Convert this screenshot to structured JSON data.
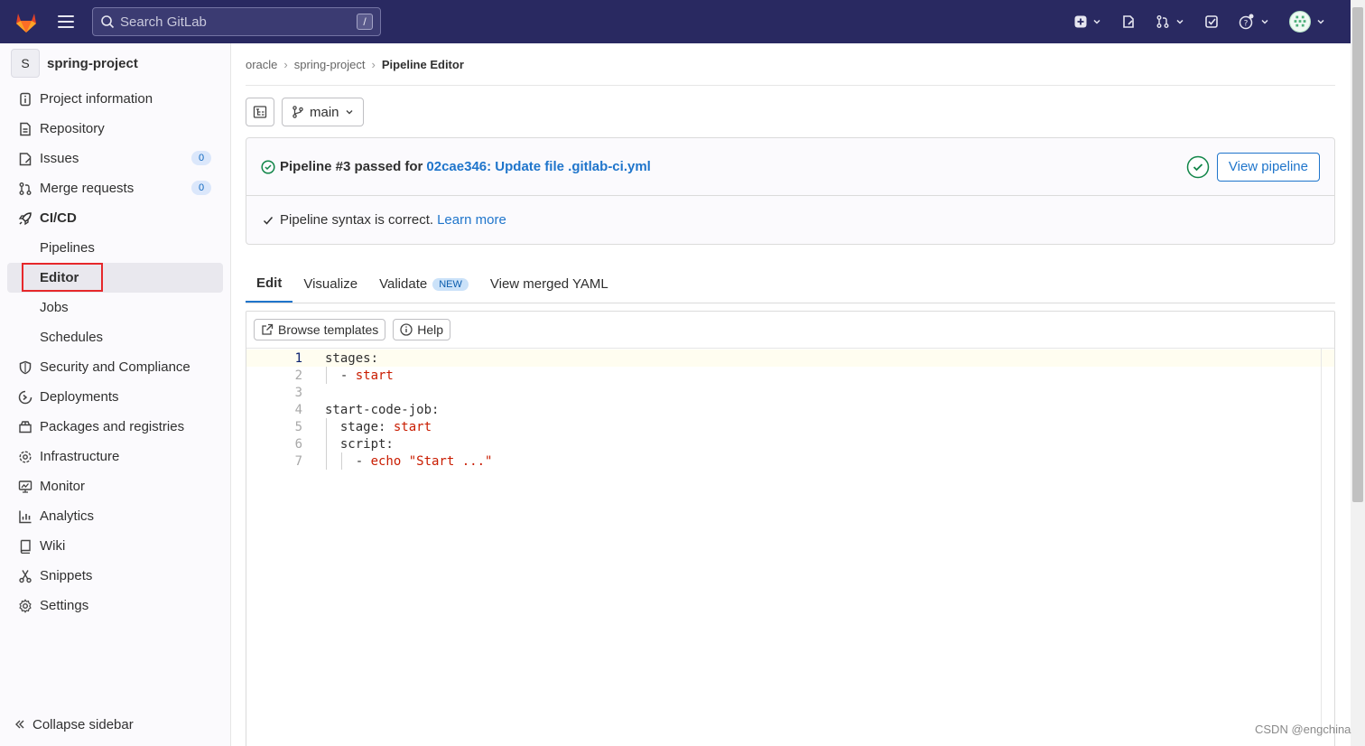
{
  "search": {
    "placeholder": "Search GitLab",
    "shortcut": "/"
  },
  "project": {
    "avatar_letter": "S",
    "name": "spring-project"
  },
  "sidebar": {
    "items": [
      {
        "label": "Project information",
        "icon": "info-icon"
      },
      {
        "label": "Repository",
        "icon": "document-icon"
      },
      {
        "label": "Issues",
        "icon": "issues-icon",
        "badge": "0"
      },
      {
        "label": "Merge requests",
        "icon": "merge-request-icon",
        "badge": "0"
      },
      {
        "label": "CI/CD",
        "icon": "rocket-icon"
      }
    ],
    "cicd_sub": [
      "Pipelines",
      "Editor",
      "Jobs",
      "Schedules"
    ],
    "items_after": [
      {
        "label": "Security and Compliance",
        "icon": "shield-icon"
      },
      {
        "label": "Deployments",
        "icon": "deployments-icon"
      },
      {
        "label": "Packages and registries",
        "icon": "package-icon"
      },
      {
        "label": "Infrastructure",
        "icon": "cloud-gear-icon"
      },
      {
        "label": "Monitor",
        "icon": "monitor-icon"
      },
      {
        "label": "Analytics",
        "icon": "chart-icon"
      },
      {
        "label": "Wiki",
        "icon": "book-icon"
      },
      {
        "label": "Snippets",
        "icon": "scissors-icon"
      },
      {
        "label": "Settings",
        "icon": "gear-icon"
      }
    ],
    "collapse_label": "Collapse sidebar"
  },
  "breadcrumb": [
    "oracle",
    "spring-project",
    "Pipeline Editor"
  ],
  "branch": "main",
  "pipeline_status": {
    "label": "Pipeline #3 passed for",
    "commit": "02cae346: Update file .gitlab-ci.yml",
    "view_button": "View pipeline",
    "lint_text": "Pipeline syntax is correct.",
    "learn_more": "Learn more"
  },
  "tabs": [
    {
      "label": "Edit"
    },
    {
      "label": "Visualize"
    },
    {
      "label": "Validate",
      "badge": "NEW"
    },
    {
      "label": "View merged YAML"
    }
  ],
  "editor_tools": {
    "browse": "Browse templates",
    "help": "Help"
  },
  "code_lines": [
    {
      "n": "1",
      "t": "stages:"
    },
    {
      "n": "2",
      "t": "  - ",
      "k": "start"
    },
    {
      "n": "3",
      "t": ""
    },
    {
      "n": "4",
      "t": "start-code-job:"
    },
    {
      "n": "5",
      "t": "  stage: ",
      "k": "start"
    },
    {
      "n": "6",
      "t": "  script:"
    },
    {
      "n": "7",
      "t": "    - ",
      "k": "echo \"Start ...\""
    }
  ],
  "watermark": "CSDN @engchina",
  "colors": {
    "nav_bg": "#292961",
    "link": "#1f75cb",
    "success": "#108548",
    "highlight": "#e6282b"
  }
}
